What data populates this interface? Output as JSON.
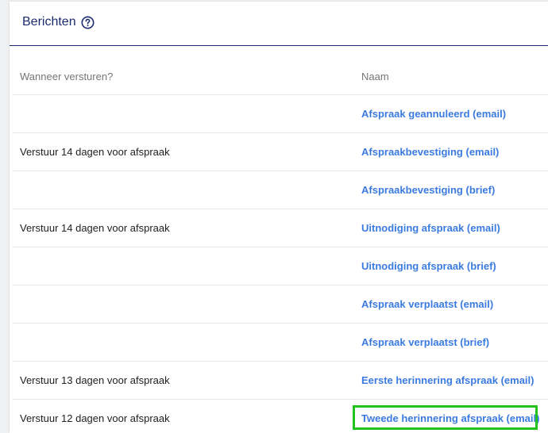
{
  "panel": {
    "title": "Berichten",
    "help_icon": "question-circle-icon"
  },
  "table": {
    "columns": [
      "Wanneer versturen?",
      "Naam"
    ],
    "rows": [
      {
        "when": "",
        "name": "Afspraak geannuleerd (email)"
      },
      {
        "when": "Verstuur 14 dagen voor afspraak",
        "name": "Afspraakbevestiging (email)"
      },
      {
        "when": "",
        "name": "Afspraakbevestiging (brief)"
      },
      {
        "when": "Verstuur 14 dagen voor afspraak",
        "name": "Uitnodiging afspraak (email)"
      },
      {
        "when": "",
        "name": "Uitnodiging afspraak (brief)"
      },
      {
        "when": "",
        "name": "Afspraak verplaatst (email)"
      },
      {
        "when": "",
        "name": "Afspraak verplaatst (brief)"
      },
      {
        "when": "Verstuur 13 dagen voor afspraak",
        "name": "Eerste herinnering afspraak (email)"
      },
      {
        "when": "Verstuur 12 dagen voor afspraak",
        "name": "Tweede herinnering afspraak (email)"
      }
    ]
  },
  "colors": {
    "title": "#1c2a70",
    "link": "#3b7be0",
    "highlight": "#22c31e",
    "header_text": "#757575"
  }
}
